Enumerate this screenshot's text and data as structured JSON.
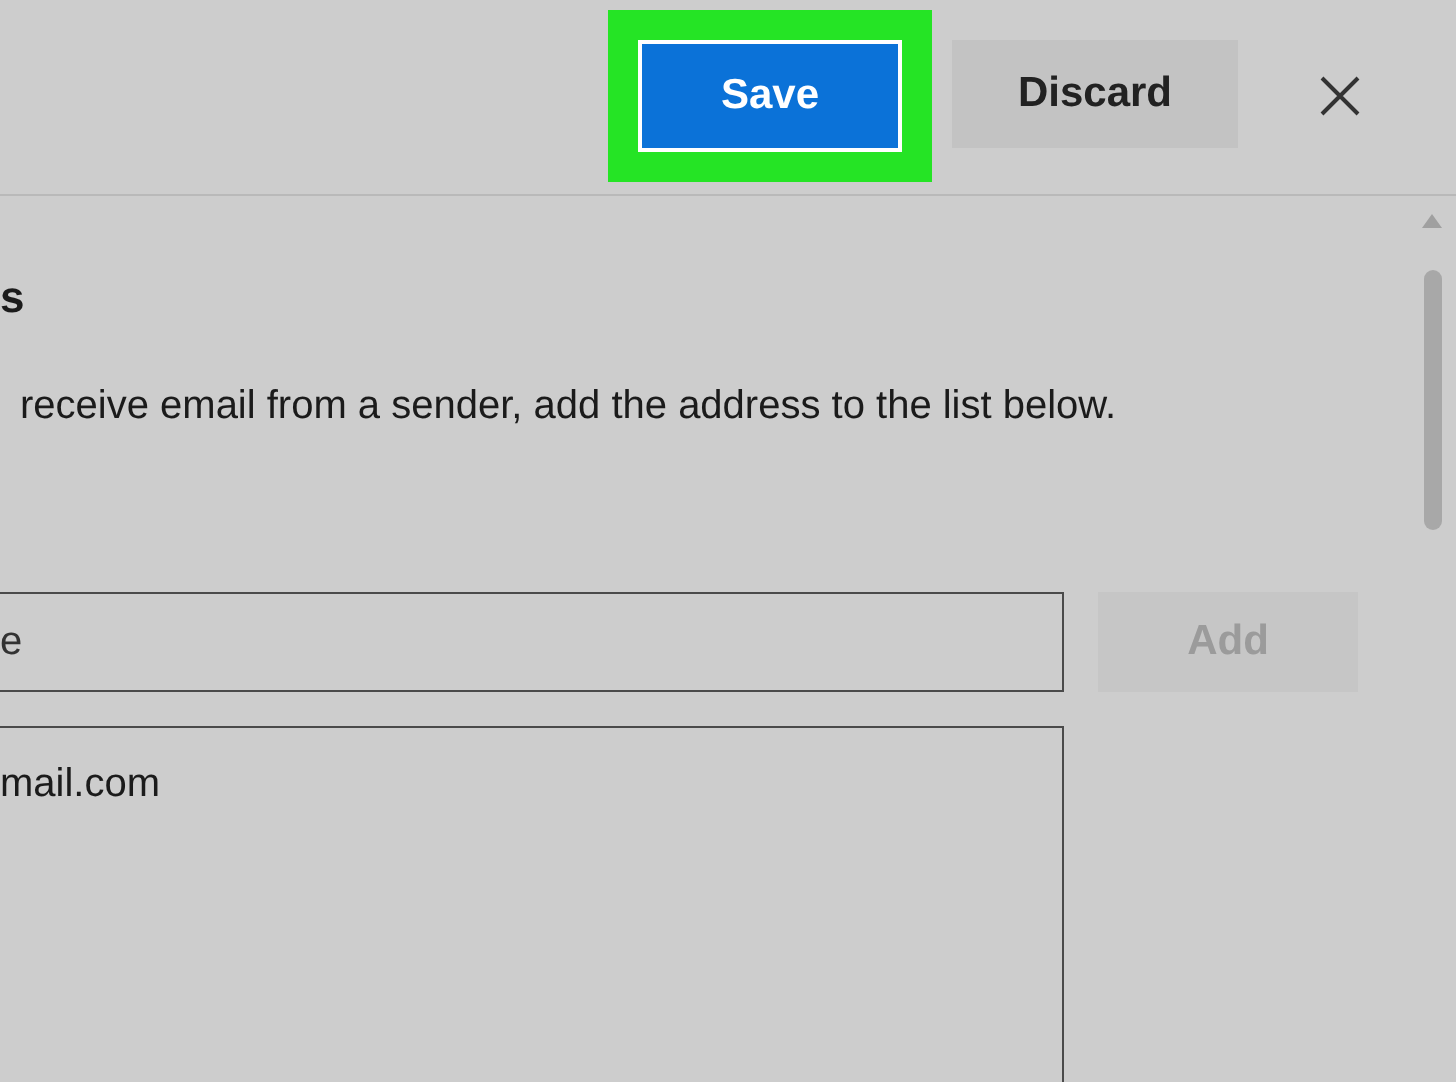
{
  "toolbar": {
    "save_button": {
      "label": "Save",
      "highlighted": true
    },
    "discard_button": {
      "label": "Discard"
    }
  },
  "section": {
    "heading": "s",
    "description": "receive email from a sender, add the address to the list below."
  },
  "address_field": {
    "value": "e"
  },
  "add_button": {
    "label": "Add",
    "disabled": true
  },
  "address_list": {
    "items": [
      "mail.com"
    ]
  }
}
